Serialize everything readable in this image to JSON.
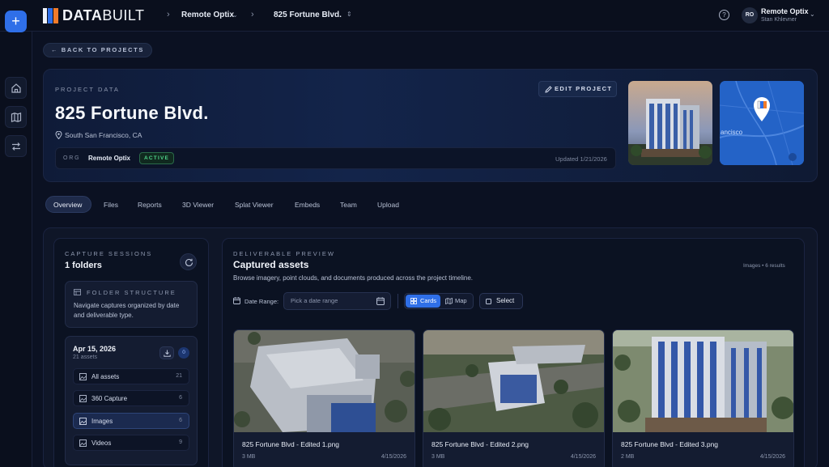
{
  "brand": {
    "logo_bold": "DATA",
    "logo_rest": "BUILT"
  },
  "breadcrumb": {
    "org": "Remote Optix",
    "project": "825 Fortune Blvd."
  },
  "user": {
    "initials": "RO",
    "name": "Remote Optix",
    "subtitle": "Stan Khlevner"
  },
  "back_label": "BACK TO PROJECTS",
  "project": {
    "section_label": "PROJECT DATA",
    "title": "825 Fortune Blvd.",
    "location": "South San Francisco, CA",
    "edit_label": "EDIT PROJECT",
    "org_label": "ORG",
    "org_name": "Remote Optix",
    "status": "ACTIVE",
    "updated": "Updated 1/21/2026",
    "map_label": "ancisco"
  },
  "tabs": [
    {
      "label": "Overview",
      "active": true
    },
    {
      "label": "Files"
    },
    {
      "label": "Reports"
    },
    {
      "label": "3D Viewer"
    },
    {
      "label": "Splat Viewer"
    },
    {
      "label": "Embeds"
    },
    {
      "label": "Team"
    },
    {
      "label": "Upload"
    }
  ],
  "sessions": {
    "label": "CAPTURE SESSIONS",
    "count": "1 folders",
    "folder_title": "FOLDER STRUCTURE",
    "folder_desc": "Navigate captures organized by date and deliverable type.",
    "date": "Apr 15, 2026",
    "date_sub": "21 assets",
    "badge": "0",
    "items": [
      {
        "label": "All assets",
        "count": "21"
      },
      {
        "label": "360 Capture",
        "count": "6"
      },
      {
        "label": "Images",
        "count": "6",
        "active": true
      },
      {
        "label": "Videos",
        "count": "9"
      }
    ]
  },
  "deliverables": {
    "label": "DELIVERABLE PREVIEW",
    "title": "Captured assets",
    "desc": "Browse imagery, point clouds, and documents produced across the project timeline.",
    "count": "Images • 6 results",
    "date_range_label": "Date Range:",
    "date_placeholder": "Pick a date range",
    "view_cards": "Cards",
    "view_map": "Map",
    "select_label": "Select",
    "assets": [
      {
        "name": "825 Fortune Blvd - Edited 1.png",
        "size": "3 MB",
        "date": "4/15/2026"
      },
      {
        "name": "825 Fortune Blvd - Edited 2.png",
        "size": "3 MB",
        "date": "4/15/2026"
      },
      {
        "name": "825 Fortune Blvd - Edited 3.png",
        "size": "2 MB",
        "date": "4/15/2026"
      }
    ]
  },
  "colors": {
    "accent": "#2f6fe8",
    "active_green": "#4fd38b",
    "background": "#0b1122"
  }
}
